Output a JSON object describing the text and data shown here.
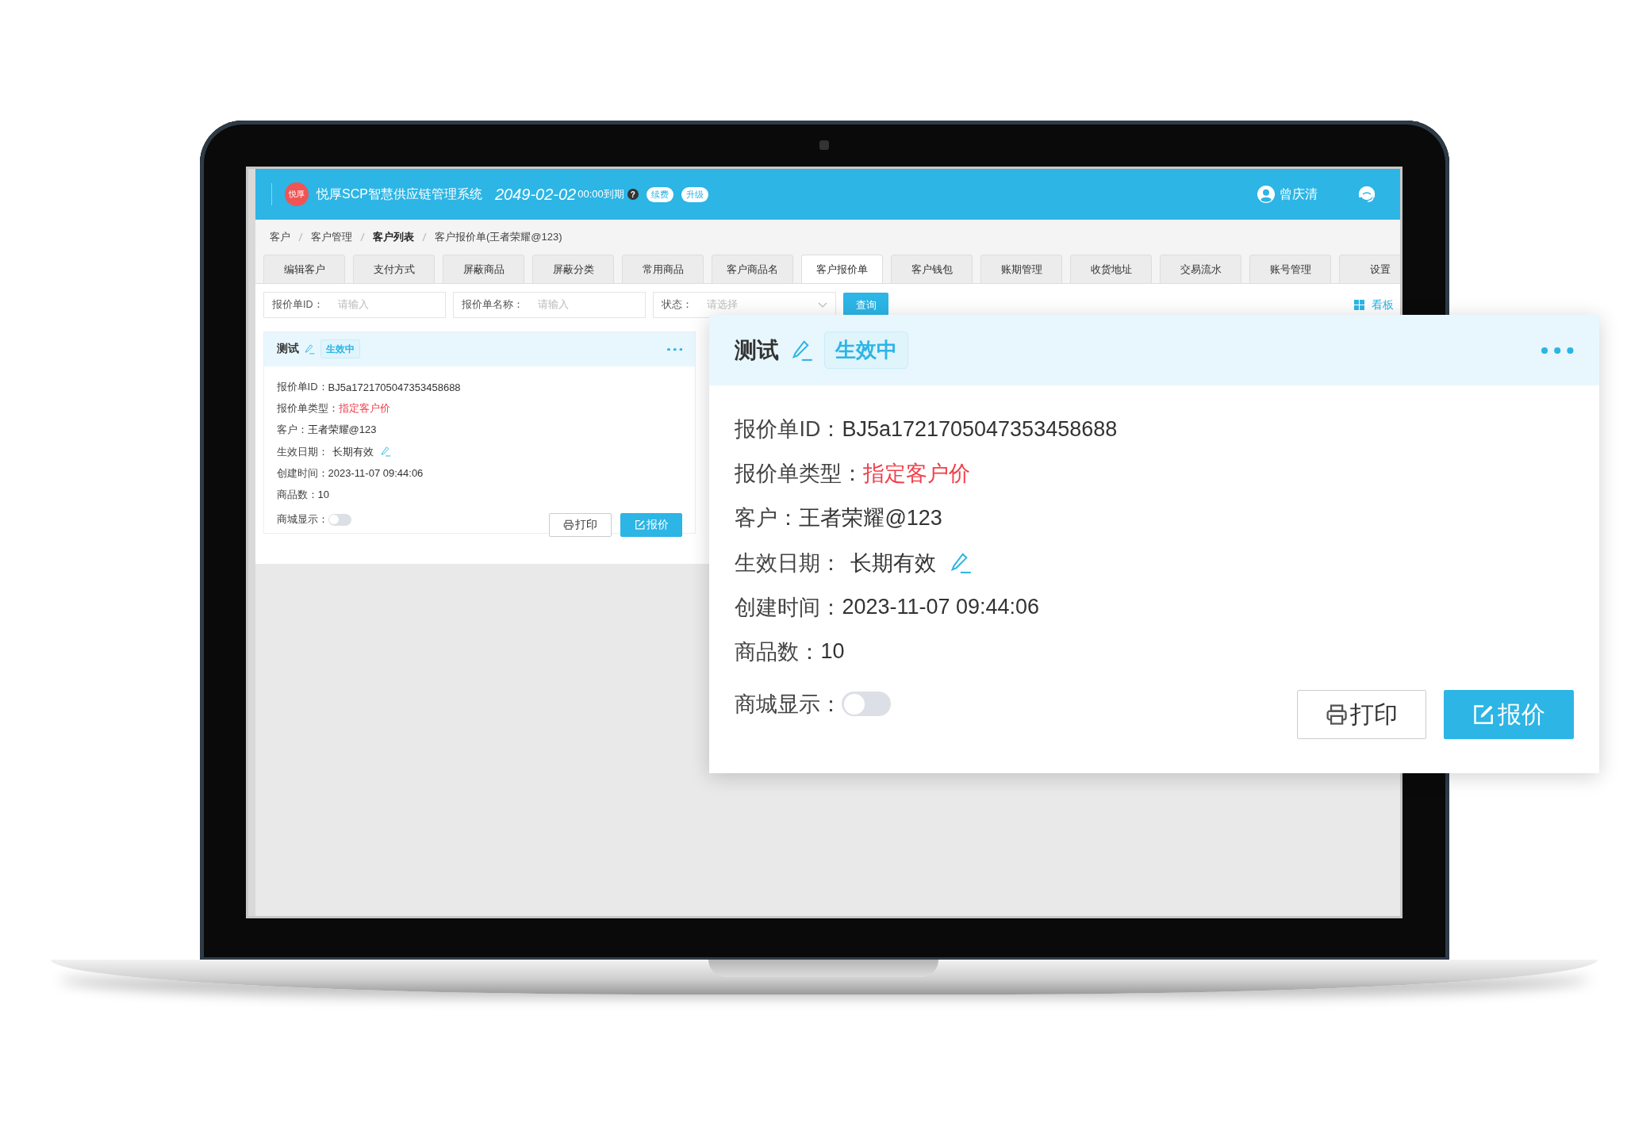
{
  "header": {
    "logo": "悦厚",
    "title": "悦厚SCP智慧供应链管理系统",
    "expiry_date": "2049-02-02",
    "expiry_time": "00:00到期",
    "help": "?",
    "badges": [
      "续费",
      "升级"
    ],
    "user": "曾庆清"
  },
  "breadcrumb": [
    {
      "label": "客户",
      "bold": false
    },
    {
      "label": "客户管理",
      "bold": false
    },
    {
      "label": "客户列表",
      "bold": true
    },
    {
      "label": "客户报价单(王者荣耀@123)",
      "bold": false
    }
  ],
  "tabs": [
    {
      "label": "编辑客户",
      "selected": false
    },
    {
      "label": "支付方式",
      "selected": false
    },
    {
      "label": "屏蔽商品",
      "selected": false
    },
    {
      "label": "屏蔽分类",
      "selected": false
    },
    {
      "label": "常用商品",
      "selected": false
    },
    {
      "label": "客户商品名",
      "selected": false
    },
    {
      "label": "客户报价单",
      "selected": true
    },
    {
      "label": "客户钱包",
      "selected": false
    },
    {
      "label": "账期管理",
      "selected": false
    },
    {
      "label": "收货地址",
      "selected": false
    },
    {
      "label": "交易流水",
      "selected": false
    },
    {
      "label": "账号管理",
      "selected": false
    },
    {
      "label": "设置",
      "selected": false
    }
  ],
  "filters": [
    {
      "kind": "input",
      "label": "报价单ID：",
      "placeholder": "请输入"
    },
    {
      "kind": "input",
      "label": "报价单名称：",
      "placeholder": "请输入"
    },
    {
      "kind": "select",
      "label": "状态：",
      "placeholder": "请选择"
    }
  ],
  "search_button": "查询",
  "board_link": "看板",
  "quote_card": {
    "title": "测试",
    "status": "生效中",
    "fields": [
      {
        "kind": "text",
        "label": "报价单ID：",
        "value": "BJ5a1721705047353458688"
      },
      {
        "kind": "highlight",
        "label": "报价单类型：",
        "value": "指定客户价"
      },
      {
        "kind": "text",
        "label": "客户：",
        "value": "王者荣耀@123"
      },
      {
        "kind": "editable",
        "label": "生效日期：",
        "value": "长期有效"
      },
      {
        "kind": "text",
        "label": "创建时间：",
        "value": "2023-11-07 09:44:06"
      },
      {
        "kind": "text",
        "label": "商品数：",
        "value": "10"
      }
    ],
    "toggle": {
      "label": "商城显示：",
      "on": false
    },
    "buttons": [
      {
        "kind": "print",
        "label": "打印"
      },
      {
        "kind": "quote",
        "label": "报价"
      }
    ]
  },
  "zoom_card": {
    "title": "测试",
    "status": "生效中",
    "fields": [
      {
        "kind": "text",
        "label": "报价单ID：",
        "value": "BJ5a1721705047353458688"
      },
      {
        "kind": "highlight",
        "label": "报价单类型：",
        "value": "指定客户价"
      },
      {
        "kind": "text",
        "label": "客户：",
        "value": "王者荣耀@123"
      },
      {
        "kind": "editable",
        "label": "生效日期：",
        "value": "长期有效"
      },
      {
        "kind": "text",
        "label": "创建时间：",
        "value": "2023-11-07 09:44:06"
      },
      {
        "kind": "text",
        "label": "商品数：",
        "value": "10"
      }
    ],
    "toggle": {
      "label": "商城显示：",
      "on": false
    },
    "buttons": [
      {
        "kind": "print",
        "label": "打印"
      },
      {
        "kind": "quote",
        "label": "报价"
      }
    ]
  }
}
